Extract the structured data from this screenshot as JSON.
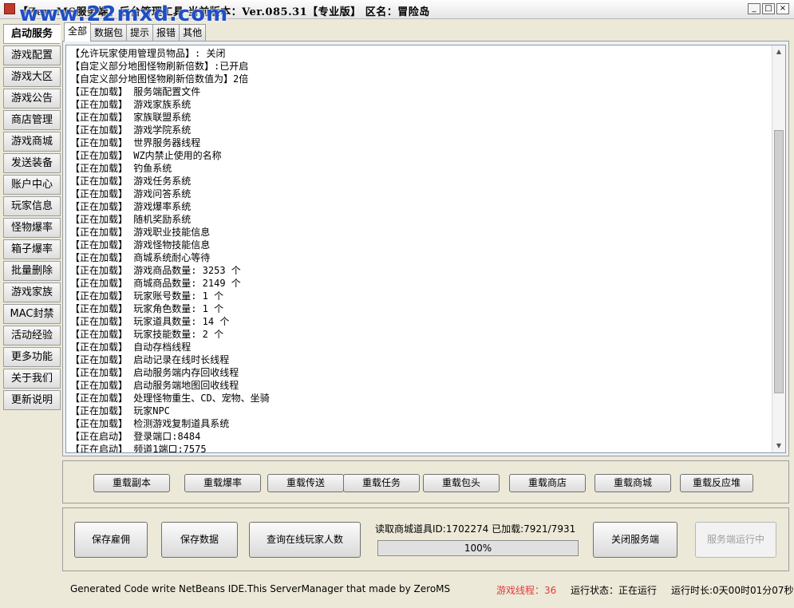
{
  "window": {
    "title": "【ZeroMS服务端】后台管理工具  当前版本：Ver.085.31【专业版】  区名：冒险岛",
    "watermark": "www.22mxd.com"
  },
  "sidebar": {
    "items": [
      {
        "label": "启动服务"
      },
      {
        "label": "游戏配置"
      },
      {
        "label": "游戏大区"
      },
      {
        "label": "游戏公告"
      },
      {
        "label": "商店管理"
      },
      {
        "label": "游戏商城"
      },
      {
        "label": "发送装备"
      },
      {
        "label": "账户中心"
      },
      {
        "label": "玩家信息"
      },
      {
        "label": "怪物爆率"
      },
      {
        "label": "箱子爆率"
      },
      {
        "label": "批量删除"
      },
      {
        "label": "游戏家族"
      },
      {
        "label": "MAC封禁"
      },
      {
        "label": "活动经验"
      },
      {
        "label": "更多功能"
      },
      {
        "label": "关于我们"
      },
      {
        "label": "更新说明"
      }
    ]
  },
  "tabs": [
    {
      "label": "全部"
    },
    {
      "label": "数据包"
    },
    {
      "label": "提示"
    },
    {
      "label": "报错"
    },
    {
      "label": "其他"
    }
  ],
  "log": {
    "lines": [
      "【允许玩家使用管理员物品】: 关闭",
      "【自定义部分地图怪物刷新倍数】:已开启",
      "【自定义部分地图怪物刷新倍数值为】2倍",
      "【正在加载】 服务端配置文件",
      "【正在加载】 游戏家族系统",
      "【正在加载】 家族联盟系统",
      "【正在加载】 游戏学院系统",
      "【正在加载】 世界服务器线程",
      "【正在加载】 WZ内禁止使用的名称",
      "【正在加载】 钓鱼系统",
      "【正在加载】 游戏任务系统",
      "【正在加载】 游戏问答系统",
      "【正在加载】 游戏爆率系统",
      "【正在加载】 随机奖励系统",
      "【正在加载】 游戏职业技能信息",
      "【正在加载】 游戏怪物技能信息",
      "【正在加载】 商城系统耐心等待",
      "【正在加载】 游戏商品数量: 3253 个",
      "【正在加载】 商城商品数量: 2149 个",
      "【正在加载】 玩家账号数量: 1 个",
      "【正在加载】 玩家角色数量: 1 个",
      "【正在加载】 玩家道具数量: 14 个",
      "【正在加载】 玩家技能数量: 2 个",
      "【正在加载】 自动存档线程",
      "【正在加载】 启动记录在线时长线程",
      "【正在加载】 启动服务端内存回收线程",
      "【正在加载】 启动服务端地图回收线程",
      "【正在加载】 处理怪物重生、CD、宠物、坐骑",
      "【正在加载】 玩家NPC",
      "【正在加载】 检测游戏复制道具系统",
      "【正在启动】 登录端口:8484",
      "【正在启动】 频道1端口:7575"
    ]
  },
  "reload_buttons": [
    {
      "label": "重载副本"
    },
    {
      "label": "重载爆率"
    },
    {
      "label": "重载传送"
    },
    {
      "label": "重载任务"
    },
    {
      "label": "重载包头"
    },
    {
      "label": "重载商店"
    },
    {
      "label": "重载商城"
    },
    {
      "label": "重载反应堆"
    }
  ],
  "controls": {
    "save_hire": "保存雇佣",
    "save_data": "保存数据",
    "query_online": "查询在线玩家人数",
    "load_info": "读取商城道具ID:1702274  已加载:7921/7931",
    "progress_text": "100%",
    "progress_value": 1.0,
    "close_server": "关闭服务端",
    "server_running": "服务端运行中"
  },
  "status": {
    "generated": "Generated Code write NetBeans IDE.This ServerManager that made by ZeroMS",
    "threads": "游戏线程：36",
    "state": "运行状态：正在运行",
    "uptime": "运行时长:0天00时01分07秒"
  },
  "colors": {
    "threads_text": "#e43a3a",
    "watermark": "#1f4fc6"
  }
}
